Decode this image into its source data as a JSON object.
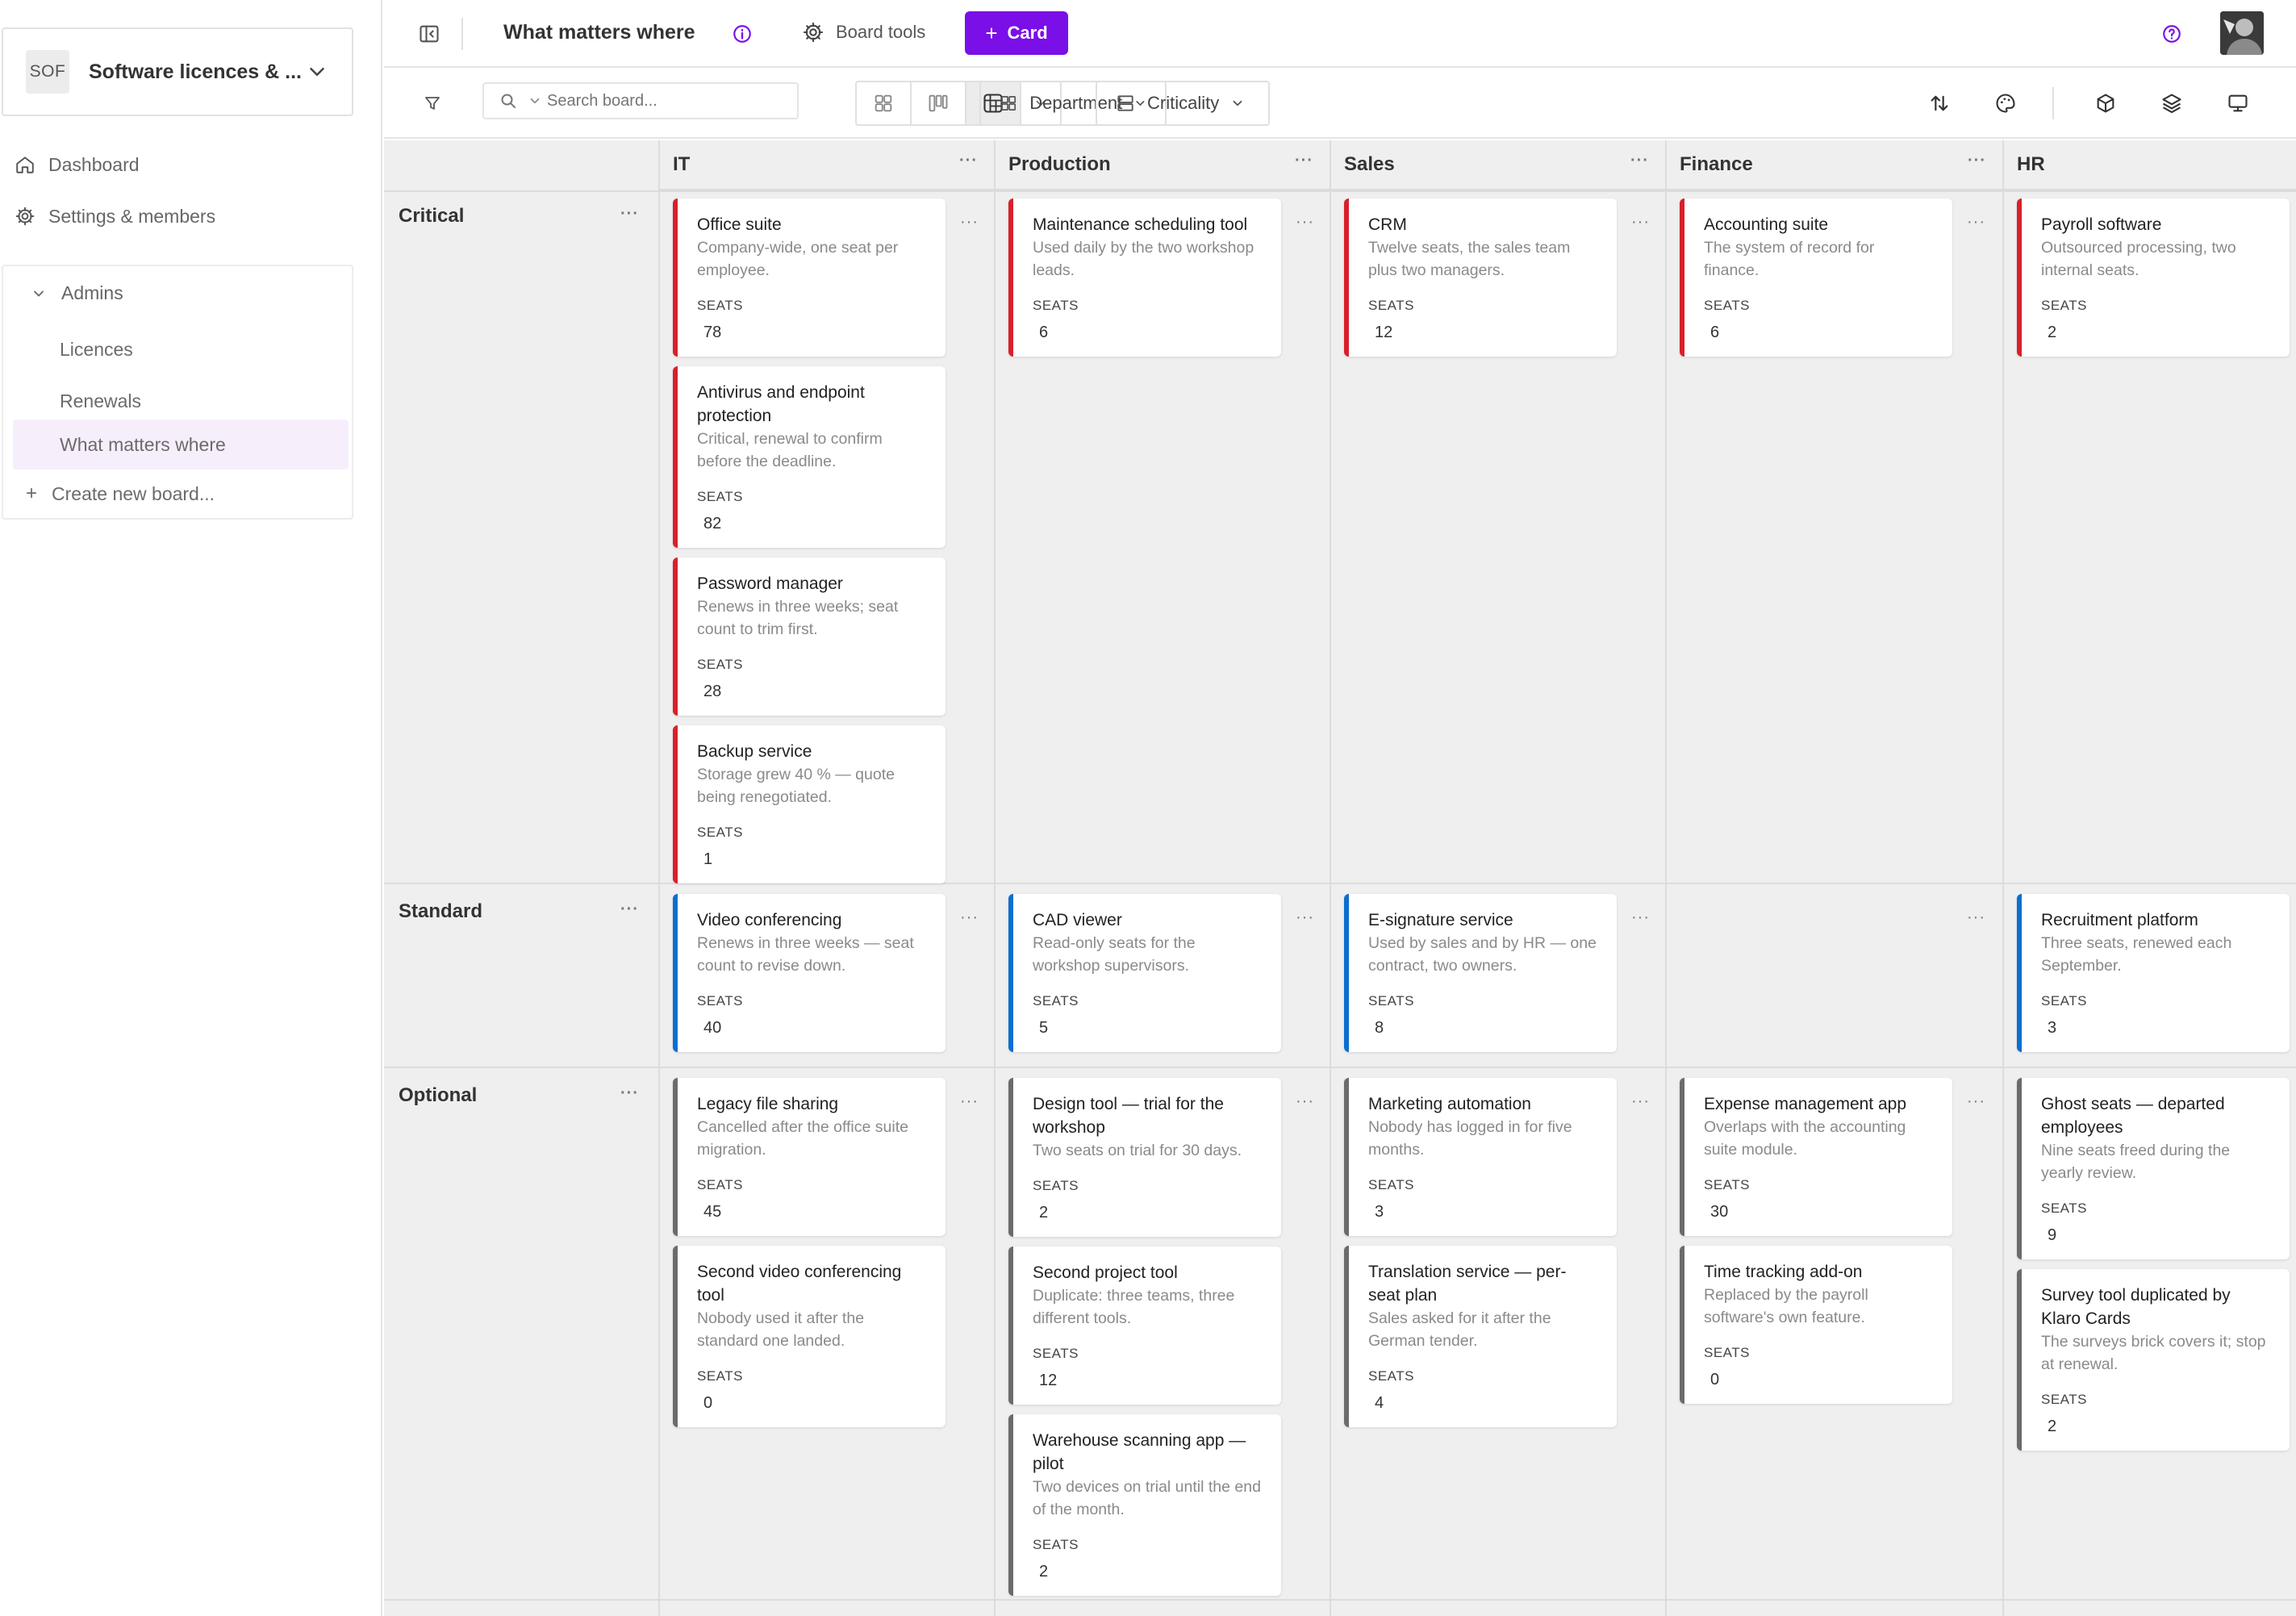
{
  "sidebar": {
    "workspace": {
      "badge": "SOF",
      "name": "Software licences & ..."
    },
    "nav": {
      "dashboard": "Dashboard",
      "settings": "Settings & members"
    },
    "group": {
      "label": "Admins",
      "boards": [
        "Licences",
        "Renewals",
        "What matters where"
      ],
      "active_board": "What matters where"
    },
    "create_board": "Create new board..."
  },
  "topbar": {
    "title": "What matters where",
    "board_tools": "Board tools",
    "add_card": "Card"
  },
  "toolbar": {
    "search_placeholder": "Search board...",
    "group_by_columns": "Department",
    "group_by_rows": "Criticality"
  },
  "colors": {
    "accent": "#7a0fe8",
    "critical": "#d9202a",
    "standard": "#0a6fd0",
    "optional": "#6b6b6b"
  },
  "board": {
    "columns": [
      "IT",
      "Production",
      "Sales",
      "Finance",
      "HR"
    ],
    "rows": [
      "Critical",
      "Standard",
      "Optional"
    ],
    "field_label": "SEATS",
    "cards": {
      "critical": {
        "it": [
          {
            "title": "Office suite",
            "desc": "Company-wide, one seat per employee.",
            "seats": "78"
          },
          {
            "title": "Antivirus and endpoint protection",
            "desc": "Critical, renewal to confirm before the deadline.",
            "seats": "82"
          },
          {
            "title": "Password manager",
            "desc": "Renews in three weeks; seat count to trim first.",
            "seats": "28"
          },
          {
            "title": "Backup service",
            "desc": "Storage grew 40 % — quote being renegotiated.",
            "seats": "1"
          }
        ],
        "production": [
          {
            "title": "Maintenance scheduling tool",
            "desc": "Used daily by the two workshop leads.",
            "seats": "6"
          }
        ],
        "sales": [
          {
            "title": "CRM",
            "desc": "Twelve seats, the sales team plus two managers.",
            "seats": "12"
          }
        ],
        "finance": [
          {
            "title": "Accounting suite",
            "desc": "The system of record for finance.",
            "seats": "6"
          }
        ],
        "hr": [
          {
            "title": "Payroll software",
            "desc": "Outsourced processing, two internal seats.",
            "seats": "2"
          }
        ]
      },
      "standard": {
        "it": [
          {
            "title": "Video conferencing",
            "desc": "Renews in three weeks — seat count to revise down.",
            "seats": "40"
          }
        ],
        "production": [
          {
            "title": "CAD viewer",
            "desc": "Read-only seats for the workshop supervisors.",
            "seats": "5"
          }
        ],
        "sales": [
          {
            "title": "E-signature service",
            "desc": "Used by sales and by HR — one contract, two owners.",
            "seats": "8"
          }
        ],
        "hr": [
          {
            "title": "Recruitment platform",
            "desc": "Three seats, renewed each September.",
            "seats": "3"
          }
        ]
      },
      "optional": {
        "it": [
          {
            "title": "Legacy file sharing",
            "desc": "Cancelled after the office suite migration.",
            "seats": "45"
          },
          {
            "title": "Second video conferencing tool",
            "desc": "Nobody used it after the standard one landed.",
            "seats": "0"
          }
        ],
        "production": [
          {
            "title": "Design tool — trial for the workshop",
            "desc": "Two seats on trial for 30 days.",
            "seats": "2"
          },
          {
            "title": "Second project tool",
            "desc": "Duplicate: three teams, three different tools.",
            "seats": "12"
          },
          {
            "title": "Warehouse scanning app — pilot",
            "desc": "Two devices on trial until the end of the month.",
            "seats": "2"
          }
        ],
        "sales": [
          {
            "title": "Marketing automation",
            "desc": "Nobody has logged in for five months.",
            "seats": "3"
          },
          {
            "title": "Translation service — per-seat plan",
            "desc": "Sales asked for it after the German tender.",
            "seats": "4"
          }
        ],
        "finance": [
          {
            "title": "Expense management app",
            "desc": "Overlaps with the accounting suite module.",
            "seats": "30"
          },
          {
            "title": "Time tracking add-on",
            "desc": "Replaced by the payroll software's own feature.",
            "seats": "0"
          }
        ],
        "hr": [
          {
            "title": "Ghost seats — departed employees",
            "desc": "Nine seats freed during the yearly review.",
            "seats": "9"
          },
          {
            "title": "Survey tool duplicated by Klaro Cards",
            "desc": "The surveys brick covers it; stop at renewal.",
            "seats": "2"
          }
        ]
      }
    }
  }
}
